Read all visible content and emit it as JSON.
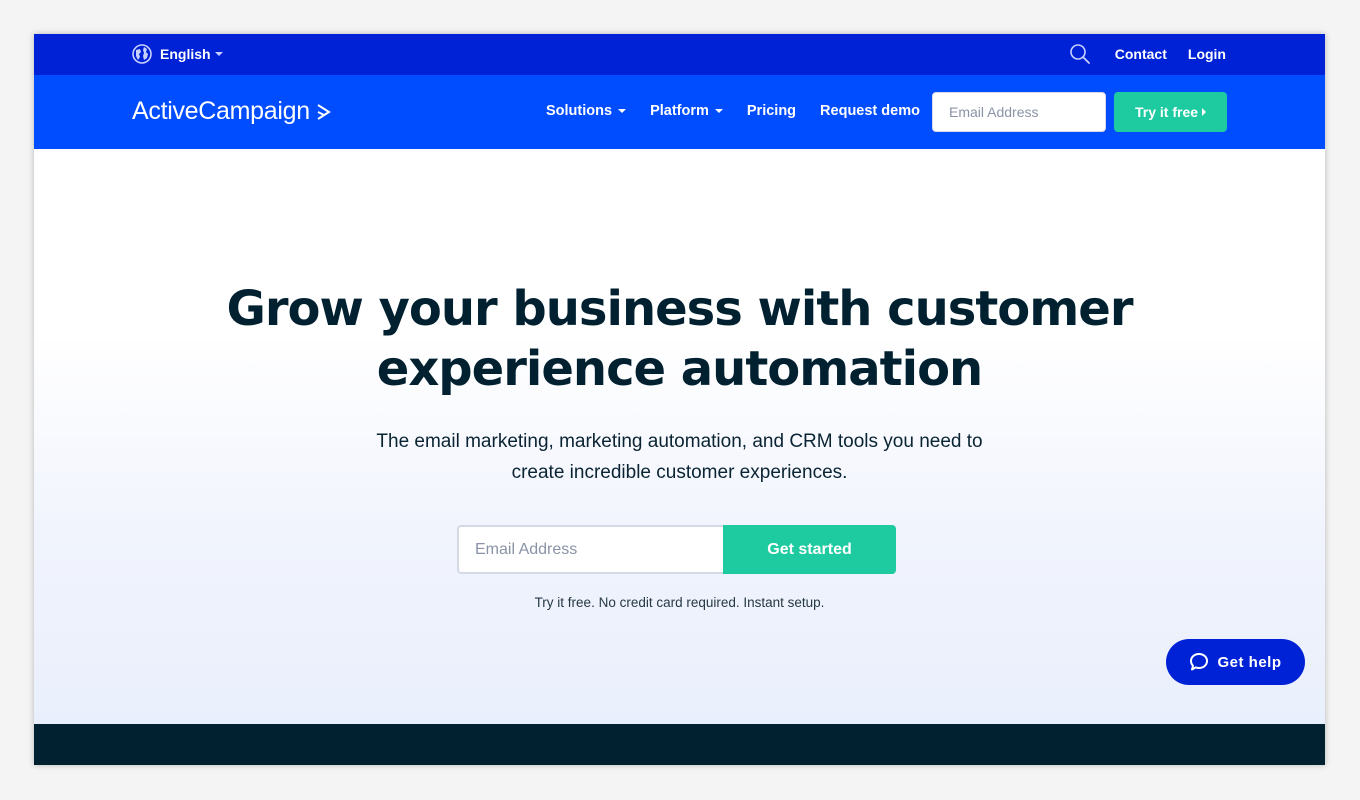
{
  "topbar": {
    "language": "English",
    "links": [
      "Contact",
      "Login"
    ]
  },
  "navbar": {
    "logo": "ActiveCampaign",
    "items": [
      {
        "label": "Solutions",
        "dropdown": true
      },
      {
        "label": "Platform",
        "dropdown": true
      },
      {
        "label": "Pricing",
        "dropdown": false
      },
      {
        "label": "Request demo",
        "dropdown": false
      }
    ],
    "email_placeholder": "Email Address",
    "cta": "Try it free"
  },
  "hero": {
    "title_line1": "Grow your business with customer",
    "title_line2": "experience automation",
    "subtitle_line1": "The email marketing, marketing automation, and CRM tools you need to",
    "subtitle_line2": "create incredible customer experiences.",
    "email_placeholder": "Email Address",
    "cta": "Get started",
    "note": "Try it free. No credit card required. Instant setup."
  },
  "help": {
    "label": "Get help"
  },
  "colors": {
    "topbar": "#0022d6",
    "navbar": "#004cff",
    "accent": "#1ecaa0",
    "heading": "#012030"
  }
}
